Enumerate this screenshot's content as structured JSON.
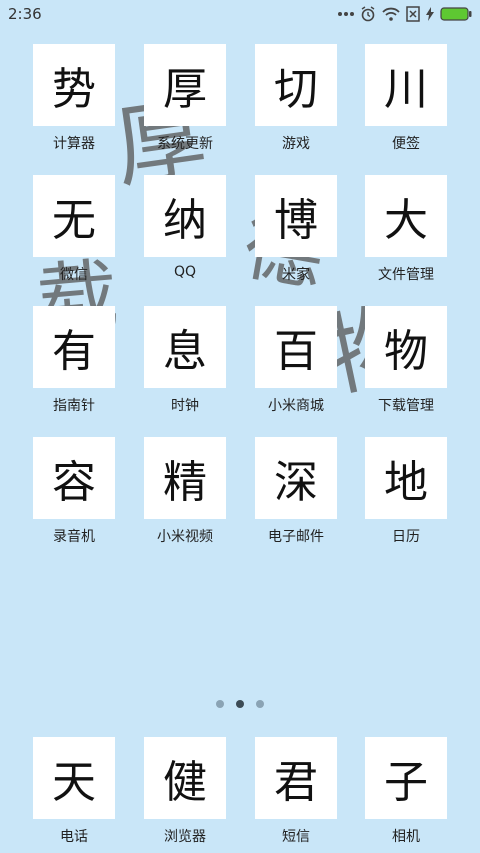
{
  "status": {
    "time": "2:36"
  },
  "apps": [
    {
      "glyph": "势",
      "label": "计算器"
    },
    {
      "glyph": "厚",
      "label": "系统更新"
    },
    {
      "glyph": "切",
      "label": "游戏"
    },
    {
      "glyph": "川",
      "label": "便签"
    },
    {
      "glyph": "无",
      "label": "微信"
    },
    {
      "glyph": "纳",
      "label": "QQ"
    },
    {
      "glyph": "博",
      "label": "米家"
    },
    {
      "glyph": "大",
      "label": "文件管理"
    },
    {
      "glyph": "有",
      "label": "指南针"
    },
    {
      "glyph": "息",
      "label": "时钟"
    },
    {
      "glyph": "百",
      "label": "小米商城"
    },
    {
      "glyph": "物",
      "label": "下载管理"
    },
    {
      "glyph": "容",
      "label": "录音机"
    },
    {
      "glyph": "精",
      "label": "小米视频"
    },
    {
      "glyph": "深",
      "label": "电子邮件"
    },
    {
      "glyph": "地",
      "label": "日历"
    }
  ],
  "dock": [
    {
      "glyph": "天",
      "label": "电话"
    },
    {
      "glyph": "健",
      "label": "浏览器"
    },
    {
      "glyph": "君",
      "label": "短信"
    },
    {
      "glyph": "子",
      "label": "相机"
    }
  ],
  "pages": {
    "count": 3,
    "active": 2
  },
  "colors": {
    "background": "#c9e6f8",
    "battery": "#5ec832"
  }
}
